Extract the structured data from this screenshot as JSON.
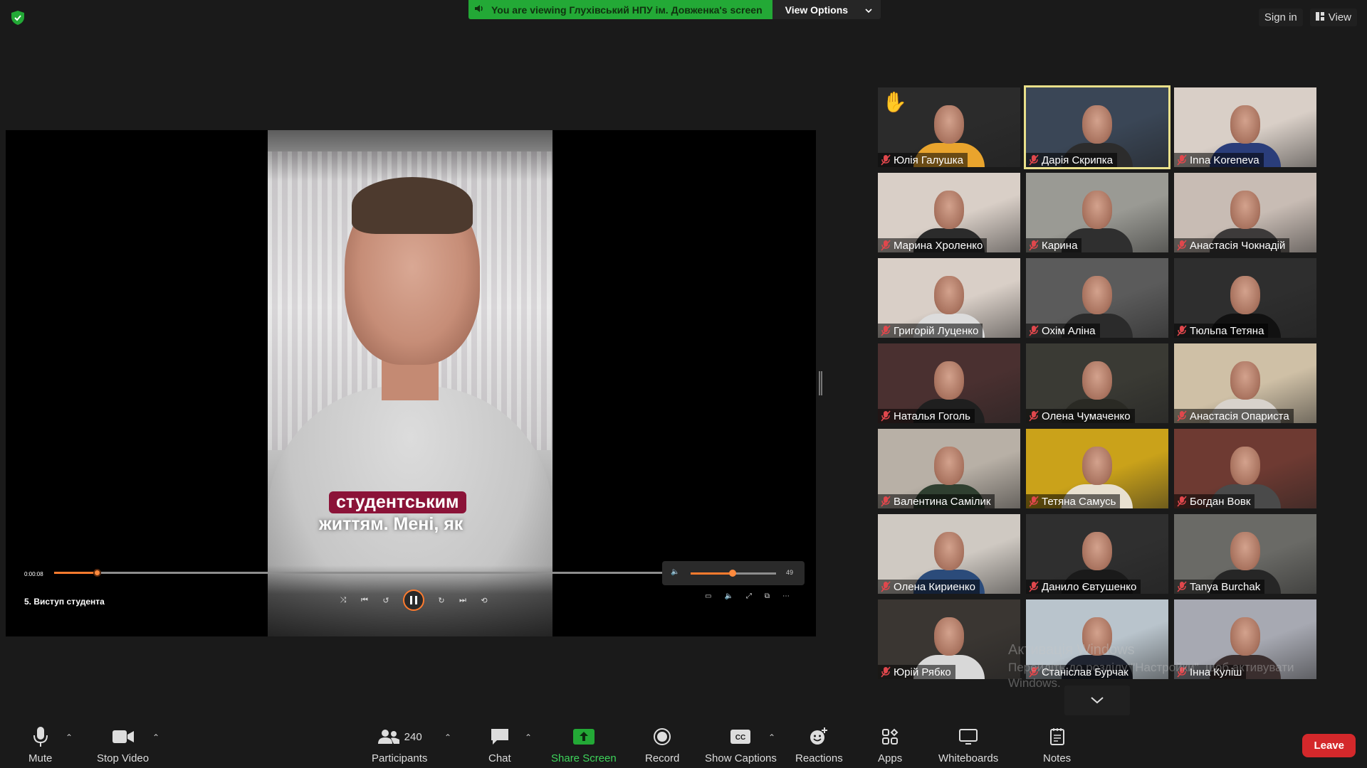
{
  "top": {
    "share_notice": "You are viewing Глухівський НПУ ім. Довженка's screen",
    "view_options": "View Options",
    "sign_in": "Sign in",
    "view": "View"
  },
  "player": {
    "current_time": "0:00:08",
    "title": "5. Виступ студента",
    "progress_fraction": 0.07,
    "volume": "49",
    "volume_fraction": 0.49,
    "caption_line1": "студентським",
    "caption_line2": "життям. Мені, як"
  },
  "participants": [
    {
      "name": "Юлія Галушка",
      "hand_raised": true,
      "bg": "#2b2b2b",
      "accent": "#e9a42d"
    },
    {
      "name": "Дарія Скрипка",
      "active_speaker": true,
      "bg": "#3a4656",
      "accent": "#2c2c2c"
    },
    {
      "name": "Inna Koreneva",
      "bg": "#d9cfc7",
      "accent": "#2a3d7a"
    },
    {
      "name": "Марина Хроленко",
      "bg": "#d9cfc7",
      "accent": "#2b2b2b"
    },
    {
      "name": "Карина",
      "bg": "#9a9a94",
      "accent": "#2f2f2f"
    },
    {
      "name": "Анастасія Чокнадій",
      "bg": "#c8bcb4",
      "accent": "#3d3a3a"
    },
    {
      "name": "Григорій Луценко",
      "bg": "#d9cfc7",
      "accent": "#dcdcdc"
    },
    {
      "name": "Охім Аліна",
      "bg": "#5b5b5b",
      "accent": "#2b2b2b"
    },
    {
      "name": "Тюльпа Тетяна",
      "bg": "#2e2e2e",
      "accent": "#111111"
    },
    {
      "name": "Наталья Гоголь",
      "bg": "#4a3030",
      "accent": "#1f1f1f"
    },
    {
      "name": "Олена Чумаченко",
      "bg": "#3a3a34",
      "accent": "#2a2a24"
    },
    {
      "name": "Анастасія Опариста",
      "bg": "#cfc0a6",
      "accent": "#d8d2cc"
    },
    {
      "name": "Валентина Самілик",
      "bg": "#b8b0a6",
      "accent": "#2f3f30"
    },
    {
      "name": "Тетяна Самусь",
      "bg": "#caa21a",
      "accent": "#e8e0d0"
    },
    {
      "name": "Богдан Вовк",
      "bg": "#6e3a32",
      "accent": "#4a4a4a"
    },
    {
      "name": "Олена Кириенко",
      "bg": "#cfc9c2",
      "accent": "#2b4b7a"
    },
    {
      "name": "Данило Євтушенко",
      "bg": "#2f2f2f",
      "accent": "#1a1a1a"
    },
    {
      "name": "Tanya Burchak",
      "bg": "#6a6a66",
      "accent": "#262626"
    },
    {
      "name": "Юрій Рябко",
      "bg": "#3a3632",
      "accent": "#d8d8d8"
    },
    {
      "name": "Станіслав Бурчак",
      "bg": "#b9c4cc",
      "accent": "#1f2430"
    },
    {
      "name": "Інна Куліш",
      "bg": "#a7a9b2",
      "accent": "#3a2e2e"
    }
  ],
  "watermark": {
    "line1": "Активація Windows",
    "line2": "Перейдіть до розділу \"Настройки\", щоб активувати",
    "line3": "Windows."
  },
  "toolbar": {
    "mute": "Mute",
    "stop_video": "Stop Video",
    "participants": "Participants",
    "participant_count": "240",
    "chat": "Chat",
    "share_screen": "Share Screen",
    "record": "Record",
    "show_captions": "Show Captions",
    "reactions": "Reactions",
    "apps": "Apps",
    "whiteboards": "Whiteboards",
    "notes": "Notes",
    "leave": "Leave"
  },
  "colors": {
    "share_green": "#23a936",
    "active_outline": "#e9e08a",
    "leave_red": "#d4282b",
    "player_accent": "#ff7b2e",
    "muted_red": "#e0474c"
  }
}
